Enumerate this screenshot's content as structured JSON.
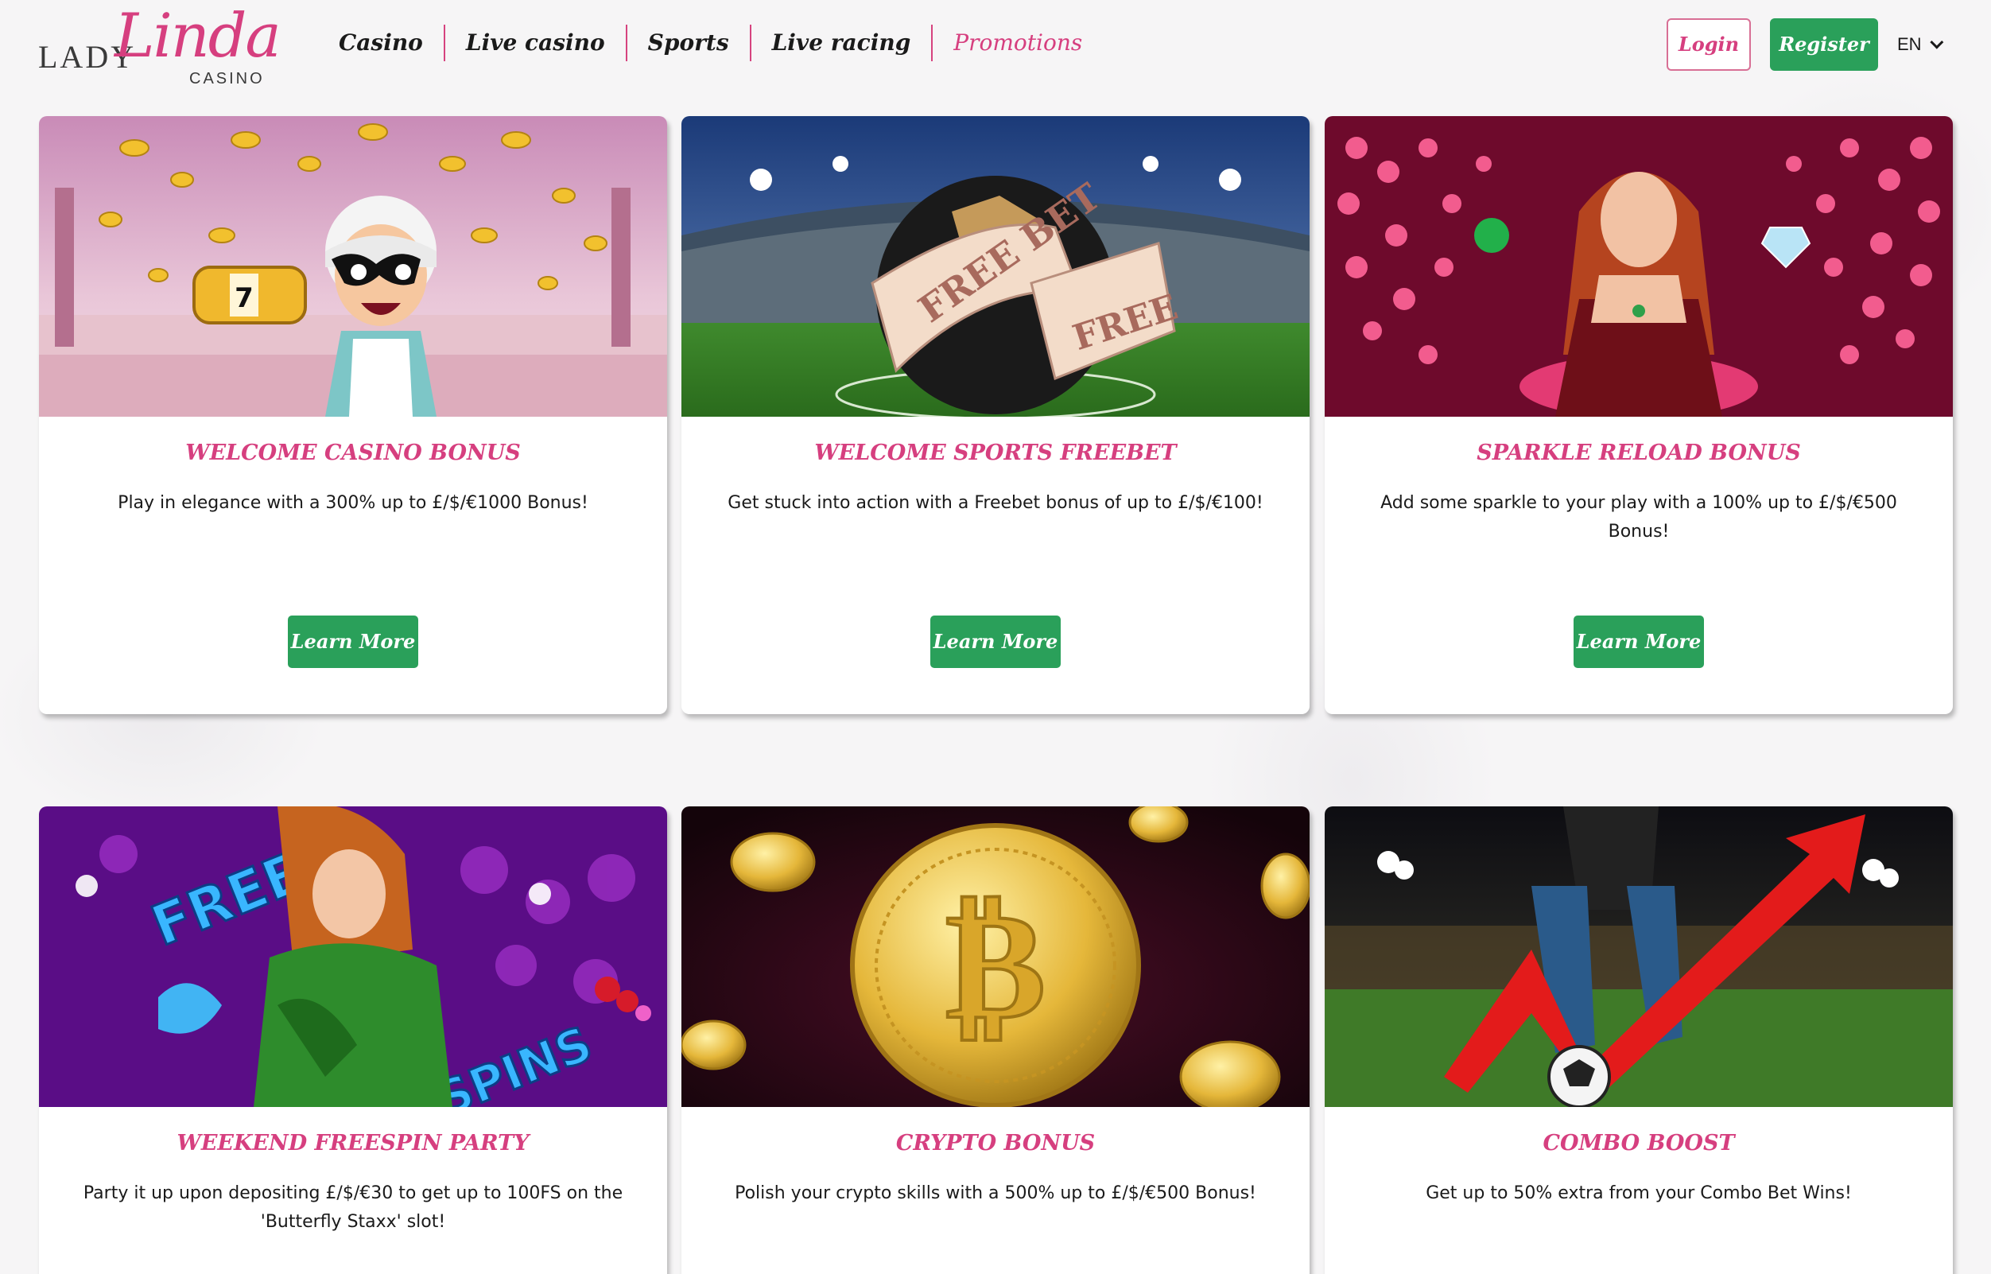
{
  "brand": {
    "lady": "LADY",
    "linda": "Linda",
    "casino": "CASINO"
  },
  "nav": [
    {
      "label": "Casino"
    },
    {
      "label": "Live casino"
    },
    {
      "label": "Sports"
    },
    {
      "label": "Live racing"
    },
    {
      "label": "Promotions"
    }
  ],
  "header": {
    "login_label": "Login",
    "register_label": "Register",
    "language": "EN"
  },
  "colors": {
    "accent": "#d63f7f",
    "green": "#2aa05a"
  },
  "promotions": [
    {
      "title": "WELCOME CASINO BONUS",
      "description": "Play in elegance with a 300% up to £/$/€1000 Bonus!",
      "button": "Learn More"
    },
    {
      "title": "WELCOME SPORTS FREEBET",
      "description": "Get stuck into action with a Freebet bonus of up to £/$/€100!",
      "button": "Learn More",
      "image_text": {
        "ticket1": "FREE BET",
        "ticket2": "FREE"
      }
    },
    {
      "title": "SPARKLE RELOAD BONUS",
      "description": "Add some sparkle to your play with a 100% up to £/$/€500 Bonus!",
      "button": "Learn More"
    },
    {
      "title": "WEEKEND FREESPIN PARTY",
      "description": "Party it up upon depositing £/$/€30 to get up to 100FS on the 'Butterfly Staxx' slot!",
      "image_text": {
        "free": "FREE",
        "spins": "SPINS"
      }
    },
    {
      "title": "CRYPTO BONUS",
      "description": "Polish your crypto skills with a 500% up to £/$/€500 Bonus!"
    },
    {
      "title": "COMBO BOOST",
      "description": "Get up to 50% extra from your Combo Bet Wins!"
    }
  ]
}
